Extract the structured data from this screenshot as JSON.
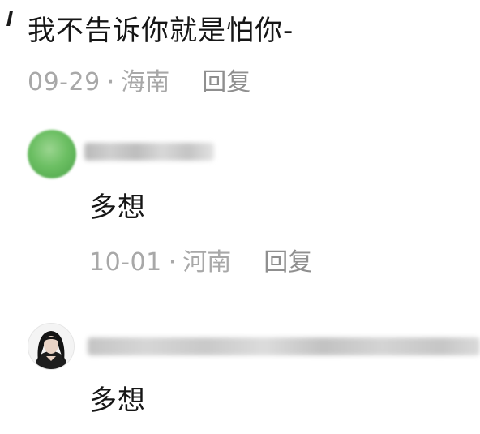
{
  "comments": [
    {
      "text": "我不告诉你就是怕你-",
      "date": "09-29",
      "separator": "·",
      "location": "海南",
      "reply_label": "回复"
    },
    {
      "text": "多想",
      "date": "10-01",
      "separator": "·",
      "location": "河南",
      "reply_label": "回复"
    },
    {
      "text": "多想"
    }
  ],
  "colors": {
    "text": "#161616",
    "meta": "#a8a8a8",
    "reply": "#8f8f8f",
    "avatar_green": "#6cbf63"
  },
  "icons": [
    "avatar-green",
    "avatar-photo"
  ]
}
